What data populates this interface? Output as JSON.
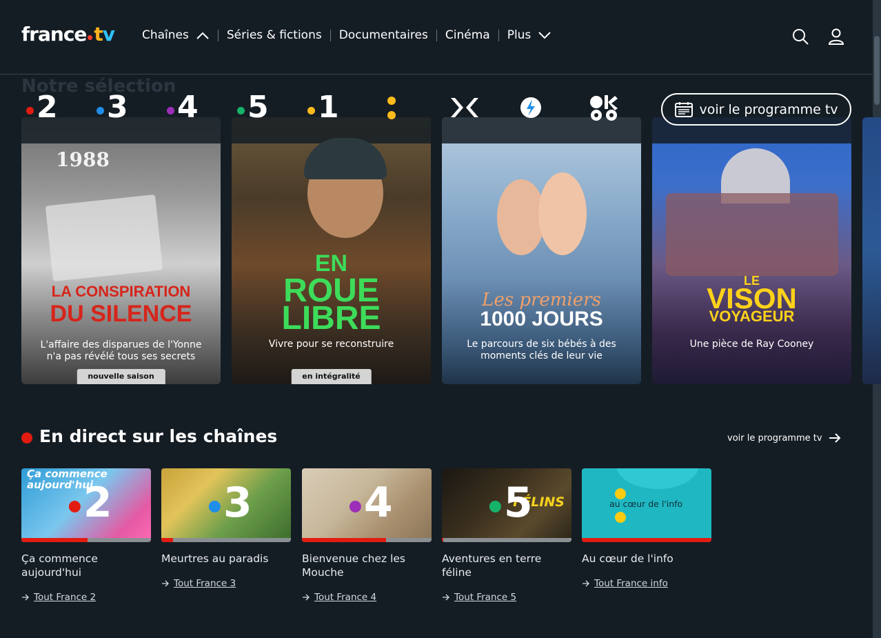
{
  "header": {
    "logo_text_1": "france",
    "logo_text_2": "t",
    "logo_text_3": "v",
    "nav": [
      {
        "label": "Chaînes"
      },
      {
        "label": "Séries & fictions"
      },
      {
        "label": "Documentaires"
      },
      {
        "label": "Cinéma"
      },
      {
        "label": "Plus"
      }
    ]
  },
  "selection": {
    "title": "Notre sélection",
    "program_button": "voir le programme tv",
    "channels": [
      {
        "label": "2",
        "color": "#e21c10"
      },
      {
        "label": "3",
        "color": "#1f8ee8"
      },
      {
        "label": "4",
        "color": "#9b2fb8"
      },
      {
        "label": "5",
        "color": "#17b26a"
      },
      {
        "label": "1",
        "color": "#ffbb1c"
      }
    ],
    "cards": [
      {
        "title_1": "LA CONSPIRATION",
        "title_2": "DU SILENCE",
        "subtitle": "L'affaire des disparues de l'Yonne n'a pas révélé tous ses secrets",
        "badge": "nouvelle saison",
        "year": "1988"
      },
      {
        "title_1": "EN",
        "title_2": "ROUE",
        "title_3": "LIBRE",
        "subtitle": "Vivre pour se reconstruire",
        "badge": "en intégralité"
      },
      {
        "title_1": "Les premiers",
        "title_2": "1000 JOURS",
        "subtitle": "Le parcours de six bébés à des moments clés de leur vie"
      },
      {
        "title_1": "LE",
        "title_2": "VISON",
        "title_3": "VOYAGEUR",
        "subtitle": "Une pièce de Ray Cooney"
      }
    ]
  },
  "live": {
    "title": "En direct sur les chaînes",
    "link": "voir le programme tv",
    "items": [
      {
        "channel": "2",
        "dot_color": "#e21c10",
        "title": "Ça commence aujourd'hui",
        "link": "Tout France 2",
        "progress": 0.51,
        "bg": "#2e9bd6",
        "overlay": "Ça commence aujourd'hui"
      },
      {
        "channel": "3",
        "dot_color": "#1f8ee8",
        "title": "Meurtres au paradis",
        "link": "Tout France 3",
        "progress": 0.09,
        "bg": "#6d9f4b",
        "overlay": ""
      },
      {
        "channel": "4",
        "dot_color": "#9b2fb8",
        "title": "Bienvenue chez les Mouche",
        "link": "Tout France 4",
        "progress": 0.65,
        "bg": "#c7b79a",
        "overlay": ""
      },
      {
        "channel": "5",
        "dot_color": "#17b26a",
        "title": "Aventures en terre féline",
        "link": "Tout France 5",
        "progress": 0.01,
        "bg": "#2a2418",
        "overlay": "FÉLINS"
      },
      {
        "channel": "",
        "dot_color": "#ffbb1c",
        "title": "Au cœur de l'info",
        "link": "Tout France info",
        "progress": 1.0,
        "bg": "#1fb8c2",
        "overlay": "au cœur de l'info"
      }
    ]
  }
}
